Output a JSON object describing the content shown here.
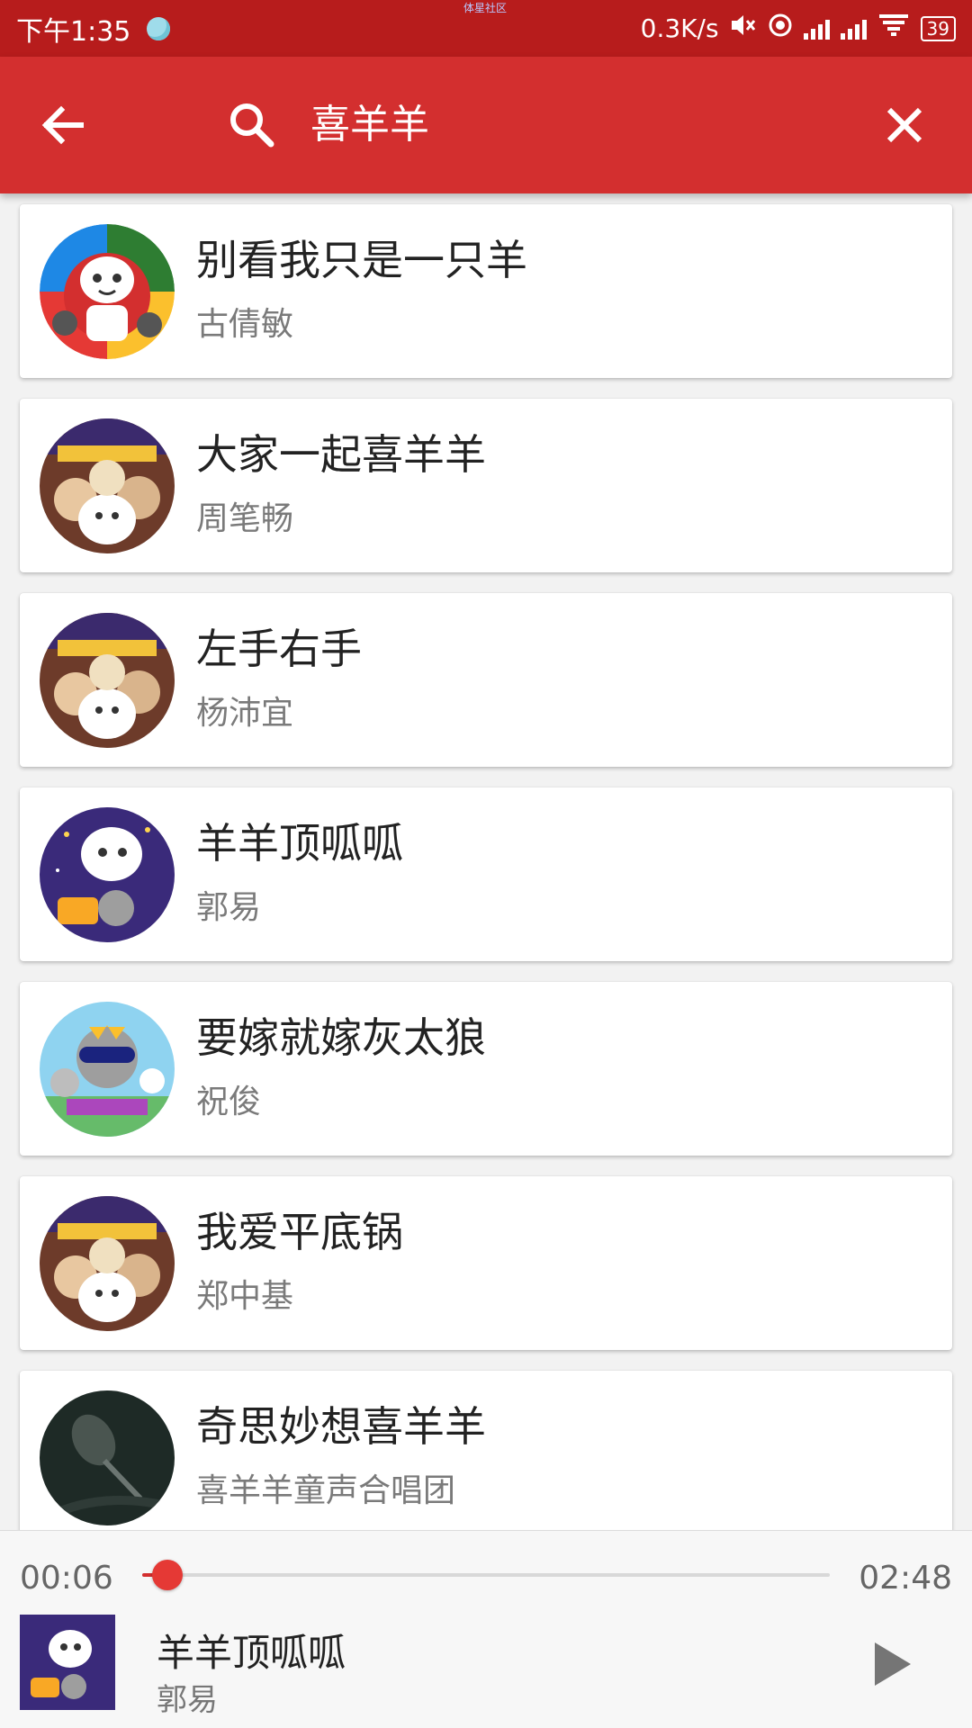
{
  "status_bar": {
    "time": "下午1:35",
    "center_text": "体星社区",
    "net_speed": "0.3K/s",
    "battery": "39"
  },
  "toolbar": {
    "query": "喜羊羊",
    "icons": [
      "arrow-left-icon",
      "search-icon",
      "close-icon"
    ]
  },
  "results": [
    {
      "title": "别看我只是一只羊",
      "artist": "古倩敏",
      "cover": "cartoon-multicolor"
    },
    {
      "title": "大家一起喜羊羊",
      "artist": "周笔畅",
      "cover": "cartoon-movie-poster"
    },
    {
      "title": "左手右手",
      "artist": "杨沛宜",
      "cover": "cartoon-movie-poster"
    },
    {
      "title": "羊羊顶呱呱",
      "artist": "郭易",
      "cover": "cartoon-night-purple"
    },
    {
      "title": "要嫁就嫁灰太狼",
      "artist": "祝俊",
      "cover": "cartoon-wolf-sky"
    },
    {
      "title": "我爱平底锅",
      "artist": "郑中基",
      "cover": "cartoon-movie-poster"
    },
    {
      "title": "奇思妙想喜羊羊",
      "artist": "喜羊羊童声合唱团",
      "cover": "microphone-dark"
    }
  ],
  "player": {
    "current_time": "00:06",
    "total_time": "02:48",
    "progress": 0.036,
    "title": "羊羊顶呱呱",
    "artist": "郭易",
    "play_icon": "play-icon"
  },
  "colors": {
    "status_bar": "#b71c1c",
    "toolbar": "#d32f2f",
    "accent": "#e53935"
  }
}
